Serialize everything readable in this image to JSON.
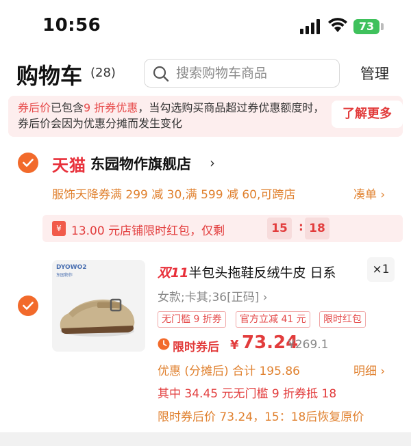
{
  "status_bar": {
    "time": "10:56",
    "battery": "73"
  },
  "header": {
    "title": "购物车",
    "count": "(28)",
    "search_placeholder": "搜索购物车商品",
    "manage_label": "管理"
  },
  "notice": {
    "part1": "券后价",
    "part2": "已包含",
    "part3": "9 折券优惠",
    "part4": "，当勾选购买商品超过券优惠额度时，券后价会因为优惠分摊而发生变化",
    "learn_more": "了解更多"
  },
  "store": {
    "platform": "天猫",
    "name": "东园物作旗舰店",
    "promo": "服饰天降券满 299 减 30,满 599 减 60,可跨店",
    "promo_action": "凑单 ›",
    "redpacket_icon": "¥",
    "redpacket_text": "13.00 元店铺限时红包，仅剩",
    "countdown_min": "15",
    "countdown_sep": ":",
    "countdown_sec": "18"
  },
  "product": {
    "brand": "DYOWO2",
    "brand_sub": "东园物作",
    "title_badge": "双11",
    "title": "半包头拖鞋反绒牛皮 日系",
    "quantity": "×1",
    "sku": "女款;卡其;36[正码] ›",
    "tags": [
      "无门槛 9 折券",
      "官方立减 41 元",
      "限时红包"
    ],
    "limit_label": "限时券后",
    "currency": "¥",
    "price": "73.24",
    "original_price": "¥269.1",
    "discount_text": "优惠 (分摊后) 合计 195.86",
    "detail_label": "明细 ›",
    "coupon_text": "其中 34.45 元无门槛 9 折券抵 18",
    "restore_text": "限时券后价 73.24，15：18后恢复原价"
  },
  "colors": {
    "accent_orange": "#f26a2b",
    "price_red": "#e23c3c",
    "tmall_red": "#e8303a",
    "promo_orange": "#e0812f",
    "notice_bg": "#fdeeee"
  }
}
